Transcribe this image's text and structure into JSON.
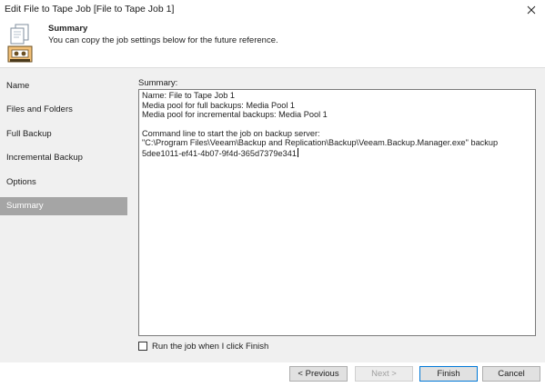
{
  "window": {
    "title": "Edit File to Tape Job [File to Tape Job 1]",
    "close_icon": "close-icon"
  },
  "header": {
    "icon": "tape-job-icon",
    "heading": "Summary",
    "description": "You can copy the job settings below for the future reference."
  },
  "steps": [
    {
      "label": "Name"
    },
    {
      "label": "Files and Folders"
    },
    {
      "label": "Full Backup"
    },
    {
      "label": "Incremental Backup"
    },
    {
      "label": "Options"
    },
    {
      "label": "Summary",
      "active": true
    }
  ],
  "summary": {
    "label": "Summary:",
    "lines": [
      "Name: File to Tape Job 1",
      "Media pool for full backups: Media Pool 1",
      "Media pool for incremental backups: Media Pool 1",
      "",
      "Command line to start the job on backup server:",
      "\"C:\\Program Files\\Veeam\\Backup and Replication\\Backup\\Veeam.Backup.Manager.exe\" backup",
      "5dee1011-ef41-4b07-9f4d-365d7379e341"
    ]
  },
  "run_checkbox": {
    "label": "Run the job when I click Finish",
    "checked": false
  },
  "buttons": {
    "previous": "< Previous",
    "next": "Next >",
    "finish": "Finish",
    "cancel": "Cancel"
  },
  "colors": {
    "active_step_bg": "#a5a5a5",
    "panel_bg": "#f0f0f0",
    "primary_button_border": "#0078d7"
  }
}
